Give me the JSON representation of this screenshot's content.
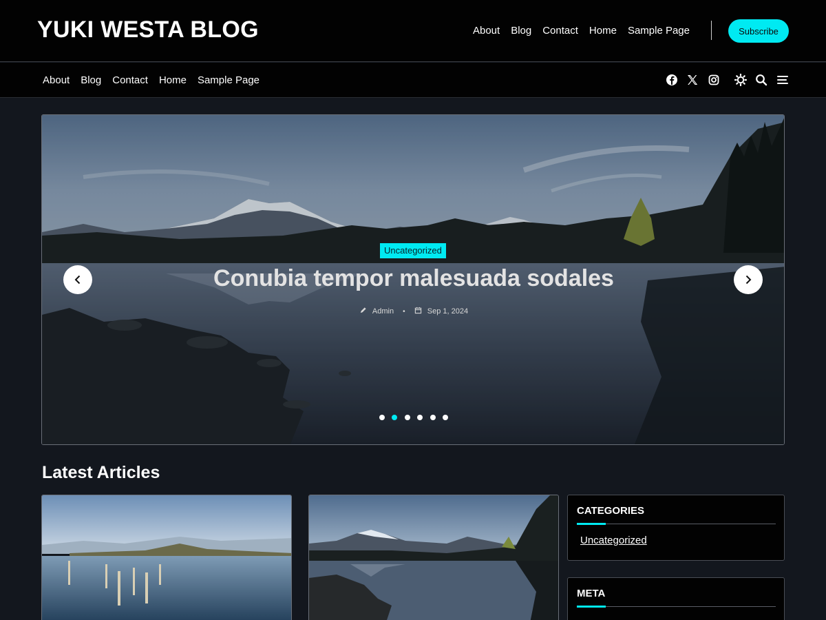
{
  "site": {
    "title": "YUKI WESTA BLOG"
  },
  "top_nav": {
    "items": [
      "About",
      "Blog",
      "Contact",
      "Home",
      "Sample Page"
    ],
    "subscribe_label": "Subscribe"
  },
  "secondary_nav": {
    "items": [
      "About",
      "Blog",
      "Contact",
      "Home",
      "Sample Page"
    ],
    "social_icons": [
      "facebook-icon",
      "x-icon",
      "instagram-icon"
    ],
    "tool_icons": [
      "theme-toggle-icon",
      "search-icon",
      "menu-icon"
    ]
  },
  "hero": {
    "category": "Uncategorized",
    "title": "Conubia tempor malesuada sodales",
    "author": "Admin",
    "date": "Sep 1, 2024",
    "slide_count": 6,
    "active_slide": 2
  },
  "latest": {
    "title": "Latest Articles"
  },
  "sidebar": {
    "categories": {
      "title": "CATEGORIES",
      "items": [
        "Uncategorized"
      ]
    },
    "meta": {
      "title": "META"
    }
  },
  "colors": {
    "accent": "#00eaf2",
    "header_bg": "#020202",
    "page_bg": "#13171e"
  }
}
